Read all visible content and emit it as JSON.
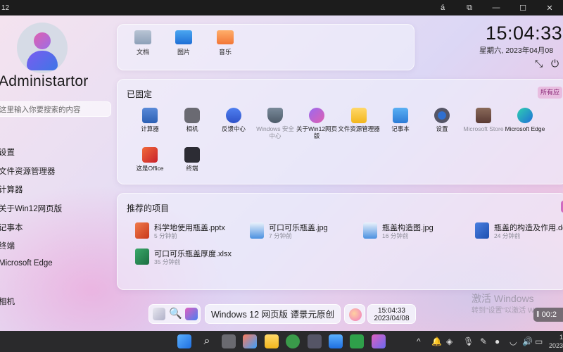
{
  "window": {
    "title": "12",
    "buttons": [
      "á",
      "⧉",
      "—",
      "☐",
      "✕"
    ]
  },
  "user": {
    "name": "Administartor",
    "search_placeholder": "这里输入你要搜索的内容"
  },
  "left_menu": [
    "设置",
    "文件资源管理器",
    "计算器",
    "关于Win12网页版",
    "记事本",
    "终端",
    "Microsoft Edge",
    "相机"
  ],
  "quick_access": [
    {
      "label": "文档",
      "icon": "documents-folder-icon"
    },
    {
      "label": "图片",
      "icon": "pictures-folder-icon"
    },
    {
      "label": "音乐",
      "icon": "music-folder-icon"
    }
  ],
  "pinned": {
    "title": "已固定",
    "all_apps": "所有应",
    "apps": [
      {
        "label": "计算器",
        "icon": "calculator-icon"
      },
      {
        "label": "相机",
        "icon": "camera-icon"
      },
      {
        "label": "反馈中心",
        "icon": "feedback-hub-icon"
      },
      {
        "label": "Windows 安全中心",
        "icon": "windows-security-icon"
      },
      {
        "label": "关于Win12网页版",
        "icon": "about-info-icon"
      },
      {
        "label": "文件资源管理器",
        "icon": "file-explorer-icon"
      },
      {
        "label": "记事本",
        "icon": "notepad-icon"
      },
      {
        "label": "设置",
        "icon": "settings-gear-icon"
      },
      {
        "label": "Microsoft Store",
        "icon": "microsoft-store-icon"
      },
      {
        "label": "Microsoft Edge",
        "icon": "edge-browser-icon"
      },
      {
        "label": "这是Office",
        "icon": "office-icon"
      },
      {
        "label": "终端",
        "icon": "terminal-icon"
      }
    ]
  },
  "recommended": {
    "title": "推荐的项目",
    "files": [
      {
        "name": "科学地使用瓶盖.pptx",
        "time": "5 分钟前",
        "icon": "powerpoint-file-icon"
      },
      {
        "name": "可口可乐瓶盖.jpg",
        "time": "7 分钟前",
        "icon": "image-file-icon"
      },
      {
        "name": "瓶盖构造图.jpg",
        "time": "16 分钟前",
        "icon": "image-file-icon"
      },
      {
        "name": "瓶盖的构造及作用.do",
        "time": "24 分钟前",
        "icon": "word-file-icon"
      },
      {
        "name": "可口可乐瓶盖厚度.xlsx",
        "time": "35 分钟前",
        "icon": "excel-file-icon"
      }
    ]
  },
  "clock": {
    "time": "15:04:33",
    "date": "星期六, 2023年04月08"
  },
  "watermark": {
    "line1": "激活 Windows",
    "line2": "转到\"设置\"以激活 W"
  },
  "recording": "‖ 00:2",
  "dock": {
    "title": "Windows 12 网页版 谭景元原创",
    "time": "15:04:33",
    "date": "2023/04/08"
  },
  "taskbar": {
    "clock_time": "1",
    "clock_date": "2023"
  },
  "colors": {
    "accent": "#8b2a78",
    "taskbar": "#2a2a2c"
  }
}
